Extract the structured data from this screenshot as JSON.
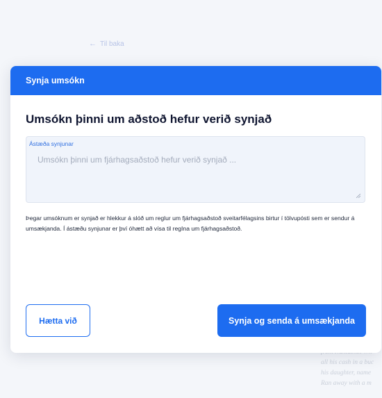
{
  "background": {
    "back_link": "Til baka",
    "quote_lines": [
      "from Nantucket Wh",
      "all his cash in a buc",
      "his daughter, name",
      "Ran away with a m"
    ]
  },
  "modal": {
    "header": "Synja umsókn",
    "title": "Umsókn þinni um aðstoð hefur verið synjað",
    "reason_field": {
      "label": "Ástæða synjunar",
      "placeholder": "Umsókn þinni um fjárhagsaðstoð hefur verið synjað ...",
      "value": ""
    },
    "info_text": "Þegar umsóknum er synjað er hlekkur á slóð um reglur um fjárhagsaðstoð sveitarfélagsins birtur í tölvupósti sem er sendur á umsækjanda. Í ástæðu synjunar er því óhætt að vísa til regIna um fjárhagsaðstoð.",
    "cancel_label": "Hætta við",
    "submit_label": "Synja og senda á umsækjanda"
  },
  "colors": {
    "primary": "#1d6cf0",
    "field_bg": "#f0f4fb",
    "page_bg": "#f4f6fa"
  },
  "icons": {
    "back": "arrow-left-icon",
    "resize": "resize-handle-icon"
  }
}
